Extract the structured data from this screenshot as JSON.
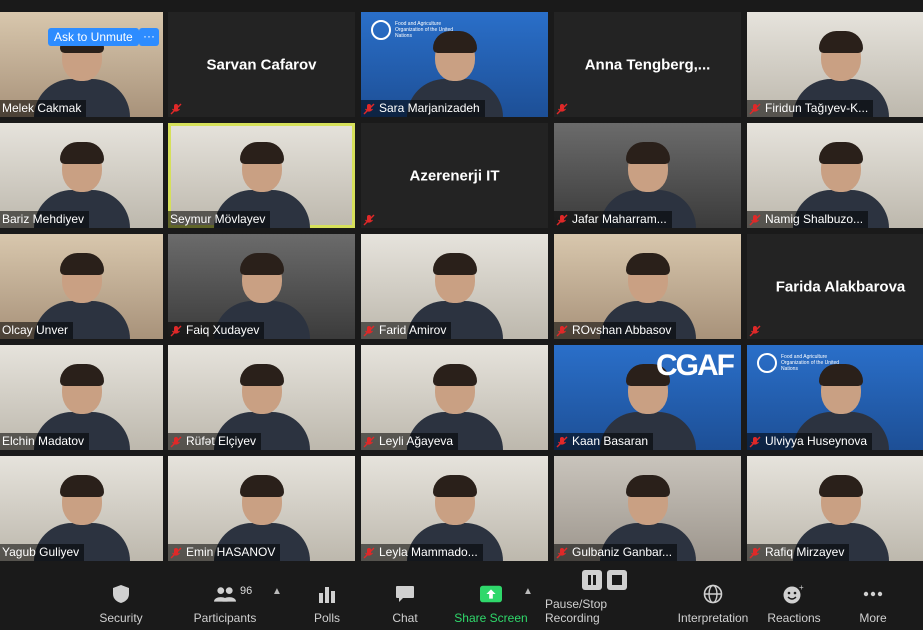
{
  "overlay": {
    "unmute_label": "Ask to Unmute",
    "more_label": "···"
  },
  "tiles": [
    {
      "name": "Melek Cakmak",
      "kind": "video",
      "muted": false
    },
    {
      "name": "Sarvan Cafarov",
      "kind": "name",
      "muted": true
    },
    {
      "name": "Sara Marjanizadeh",
      "kind": "video",
      "muted": true
    },
    {
      "name": "Anna  Tengberg,...",
      "kind": "name",
      "muted": true
    },
    {
      "name": "Firidun Tağıyev-K...",
      "kind": "video",
      "muted": true
    },
    {
      "name": "Bariz Mehdiyev",
      "kind": "video",
      "muted": false
    },
    {
      "name": "Seymur Mövlayev",
      "kind": "video",
      "muted": false
    },
    {
      "name": "Azerenerji IT",
      "kind": "name",
      "muted": true
    },
    {
      "name": "Jafar Maharram...",
      "kind": "video",
      "muted": true
    },
    {
      "name": "Namig Shalbuzo...",
      "kind": "video",
      "muted": true
    },
    {
      "name": "Olcay Unver",
      "kind": "video",
      "muted": false
    },
    {
      "name": "Faiq Xudayev",
      "kind": "video",
      "muted": true
    },
    {
      "name": "Farid Amirov",
      "kind": "video",
      "muted": true
    },
    {
      "name": "ROvshan Abbasov",
      "kind": "video",
      "muted": true
    },
    {
      "name": "Farida Alakbarova",
      "kind": "name",
      "muted": true
    },
    {
      "name": "Elchin Madatov",
      "kind": "video",
      "muted": false
    },
    {
      "name": "Rüfət Elçiyev",
      "kind": "video",
      "muted": true
    },
    {
      "name": "Leyli Ağayeva",
      "kind": "video",
      "muted": true
    },
    {
      "name": "Kaan Basaran",
      "kind": "video",
      "muted": true
    },
    {
      "name": "Ulviyya Huseynova",
      "kind": "video",
      "muted": true
    },
    {
      "name": "Yagub Guliyev",
      "kind": "video",
      "muted": false
    },
    {
      "name": "Emin HASANOV",
      "kind": "video",
      "muted": true
    },
    {
      "name": "Leyla Mammado...",
      "kind": "video",
      "muted": true
    },
    {
      "name": "Gulbaniz Ganbar...",
      "kind": "video",
      "muted": true
    },
    {
      "name": "Rafiq Mirzayev",
      "kind": "video",
      "muted": true
    }
  ],
  "fao_text": "Food and Agriculture Organization of the United Nations",
  "cgaf_text": "CGAF",
  "toolbar": {
    "security": "Security",
    "participants": "Participants",
    "participants_count": "96",
    "polls": "Polls",
    "chat": "Chat",
    "share": "Share Screen",
    "recording": "Pause/Stop Recording",
    "interpretation": "Interpretation",
    "reactions": "Reactions",
    "more": "More"
  },
  "colors": {
    "accent": "#2d8cff",
    "share_green": "#2fd86b",
    "mute_red": "#e02828",
    "active_speaker": "#d6e05a"
  }
}
